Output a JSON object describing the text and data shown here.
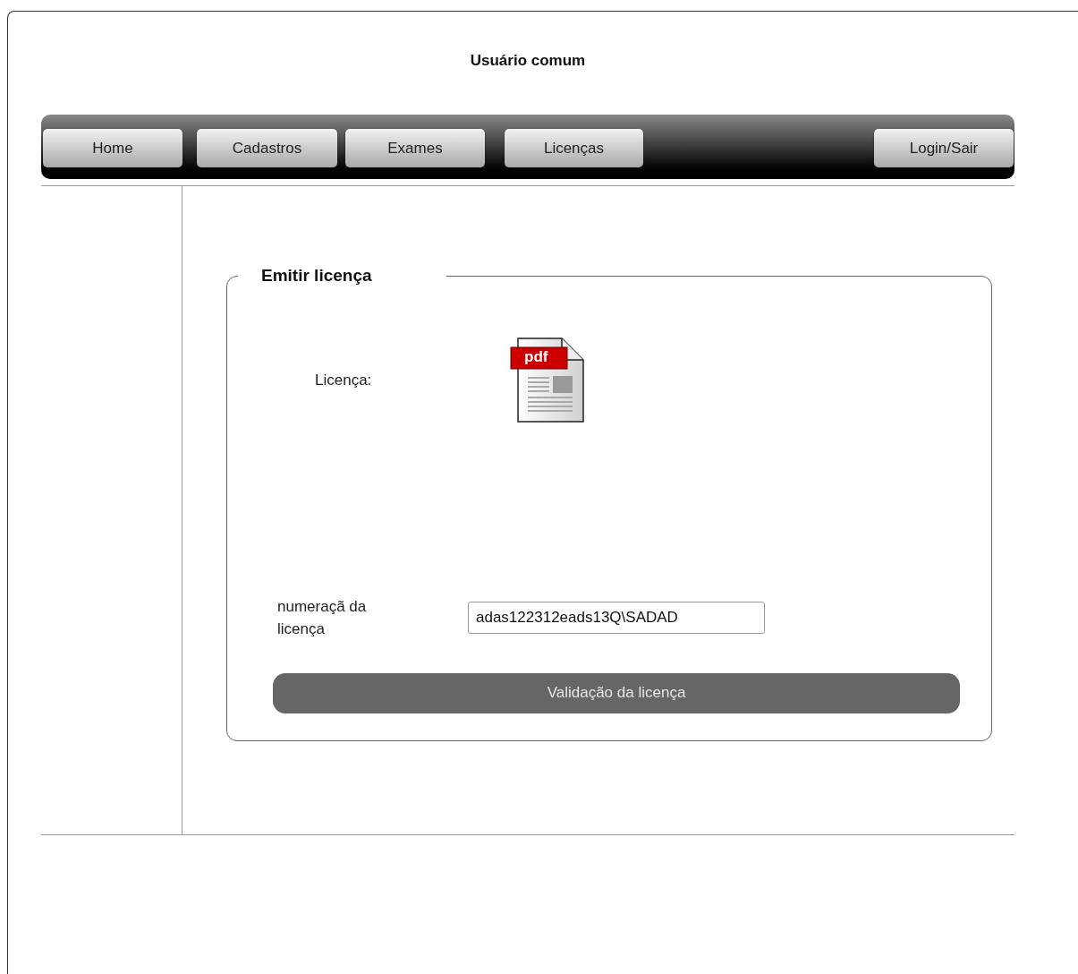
{
  "header": {
    "title": "Usuário comum"
  },
  "nav": {
    "items": [
      "Home",
      "Cadastros",
      "Exames",
      "Licenças"
    ],
    "right_items": [
      "Login/Sair"
    ]
  },
  "panel": {
    "legend": "Emitir licença",
    "license_label": "Licença:",
    "pdf_icon": {
      "label": "pdf"
    },
    "number_label": "numeraçã da licença",
    "number_value": "adas122312eads13Q\\SADAD",
    "validate_button": "Validação da licença"
  }
}
